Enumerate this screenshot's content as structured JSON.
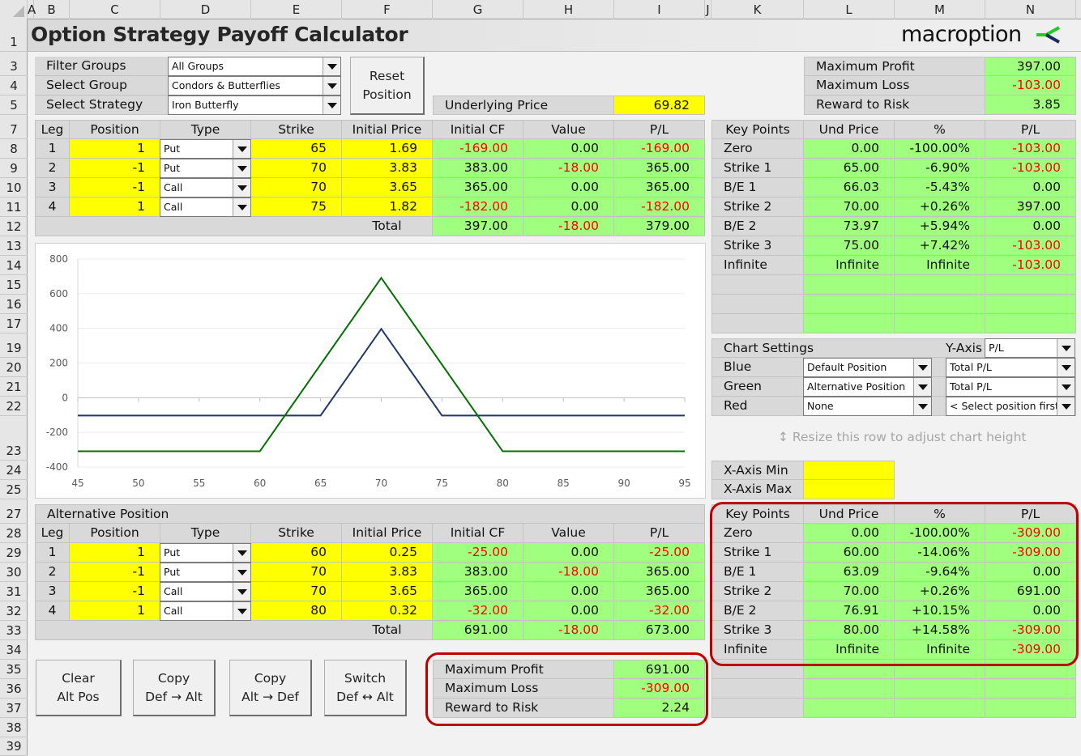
{
  "columns": [
    "A",
    "B",
    "C",
    "D",
    "E",
    "F",
    "G",
    "H",
    "I",
    "J",
    "K",
    "L",
    "M",
    "N"
  ],
  "rows": [
    "1",
    "3",
    "4",
    "5",
    "7",
    "8",
    "9",
    "10",
    "11",
    "12",
    "13",
    "14",
    "15",
    "16",
    "17",
    "19",
    "20",
    "21",
    "22",
    "23",
    "24",
    "25",
    "27",
    "28",
    "29",
    "30",
    "31",
    "32",
    "33",
    "34",
    "35",
    "36",
    "37",
    "38",
    "39"
  ],
  "title": "Option Strategy Payoff Calculator",
  "logo": "macroption",
  "filters": {
    "filter_groups_label": "Filter Groups",
    "filter_groups_value": "All Groups",
    "select_group_label": "Select Group",
    "select_group_value": "Condors & Butterflies",
    "select_strategy_label": "Select Strategy",
    "select_strategy_value": "Iron Butterfly"
  },
  "reset_button": [
    "Reset",
    "Position"
  ],
  "underlying": {
    "label": "Underlying Price",
    "value": "69.82"
  },
  "summary": {
    "max_profit_label": "Maximum Profit",
    "max_profit": "397.00",
    "max_loss_label": "Maximum Loss",
    "max_loss": "-103.00",
    "rr_label": "Reward to Risk",
    "rr": "3.85"
  },
  "legs_headers": [
    "Leg",
    "Position",
    "Type",
    "Strike",
    "Initial Price",
    "Initial CF",
    "Value",
    "P/L"
  ],
  "default_legs": [
    {
      "leg": "1",
      "position": "1",
      "type": "Put",
      "strike": "65",
      "price": "1.69",
      "cf": "-169.00",
      "value": "0.00",
      "pl": "-169.00"
    },
    {
      "leg": "2",
      "position": "-1",
      "type": "Put",
      "strike": "70",
      "price": "3.83",
      "cf": "383.00",
      "value": "-18.00",
      "pl": "365.00"
    },
    {
      "leg": "3",
      "position": "-1",
      "type": "Call",
      "strike": "70",
      "price": "3.65",
      "cf": "365.00",
      "value": "0.00",
      "pl": "365.00"
    },
    {
      "leg": "4",
      "position": "1",
      "type": "Call",
      "strike": "75",
      "price": "1.82",
      "cf": "-182.00",
      "value": "0.00",
      "pl": "-182.00"
    }
  ],
  "default_total": {
    "label": "Total",
    "cf": "397.00",
    "value": "-18.00",
    "pl": "379.00"
  },
  "key_headers": [
    "Key Points",
    "Und Price",
    "%",
    "P/L"
  ],
  "default_keys": [
    {
      "name": "Zero",
      "price": "0.00",
      "pct": "-100.00%",
      "pl": "-103.00"
    },
    {
      "name": "Strike 1",
      "price": "65.00",
      "pct": "-6.90%",
      "pl": "-103.00"
    },
    {
      "name": "B/E 1",
      "price": "66.03",
      "pct": "-5.43%",
      "pl": "0.00"
    },
    {
      "name": "Strike 2",
      "price": "70.00",
      "pct": "+0.26%",
      "pl": "397.00"
    },
    {
      "name": "B/E 2",
      "price": "73.97",
      "pct": "+5.94%",
      "pl": "0.00"
    },
    {
      "name": "Strike 3",
      "price": "75.00",
      "pct": "+7.42%",
      "pl": "-103.00"
    },
    {
      "name": "Infinite",
      "price": "Infinite",
      "pct": "Infinite",
      "pl": "-103.00"
    }
  ],
  "chart_settings": {
    "title": "Chart Settings",
    "yaxis_label": "Y-Axis",
    "yaxis_value": "P/L",
    "rows": [
      {
        "label": "Blue",
        "position": "Default Position",
        "series": "Total P/L"
      },
      {
        "label": "Green",
        "position": "Alternative Position",
        "series": "Total P/L"
      },
      {
        "label": "Red",
        "position": "None",
        "series": "< Select position first"
      }
    ]
  },
  "resize_hint": "Resize this row to adjust chart height",
  "xaxis": {
    "min_label": "X-Axis Min",
    "min_value": "",
    "max_label": "X-Axis Max",
    "max_value": ""
  },
  "alt_title": "Alternative Position",
  "alt_legs": [
    {
      "leg": "1",
      "position": "1",
      "type": "Put",
      "strike": "60",
      "price": "0.25",
      "cf": "-25.00",
      "value": "0.00",
      "pl": "-25.00"
    },
    {
      "leg": "2",
      "position": "-1",
      "type": "Put",
      "strike": "70",
      "price": "3.83",
      "cf": "383.00",
      "value": "-18.00",
      "pl": "365.00"
    },
    {
      "leg": "3",
      "position": "-1",
      "type": "Call",
      "strike": "70",
      "price": "3.65",
      "cf": "365.00",
      "value": "0.00",
      "pl": "365.00"
    },
    {
      "leg": "4",
      "position": "1",
      "type": "Call",
      "strike": "80",
      "price": "0.32",
      "cf": "-32.00",
      "value": "0.00",
      "pl": "-32.00"
    }
  ],
  "alt_total": {
    "label": "Total",
    "cf": "691.00",
    "value": "-18.00",
    "pl": "673.00"
  },
  "alt_keys": [
    {
      "name": "Zero",
      "price": "0.00",
      "pct": "-100.00%",
      "pl": "-309.00"
    },
    {
      "name": "Strike 1",
      "price": "60.00",
      "pct": "-14.06%",
      "pl": "-309.00"
    },
    {
      "name": "B/E 1",
      "price": "63.09",
      "pct": "-9.64%",
      "pl": "0.00"
    },
    {
      "name": "Strike 2",
      "price": "70.00",
      "pct": "+0.26%",
      "pl": "691.00"
    },
    {
      "name": "B/E 2",
      "price": "76.91",
      "pct": "+10.15%",
      "pl": "0.00"
    },
    {
      "name": "Strike 3",
      "price": "80.00",
      "pct": "+14.58%",
      "pl": "-309.00"
    },
    {
      "name": "Infinite",
      "price": "Infinite",
      "pct": "Infinite",
      "pl": "-309.00"
    }
  ],
  "alt_summary": {
    "max_profit_label": "Maximum Profit",
    "max_profit": "691.00",
    "max_loss_label": "Maximum Loss",
    "max_loss": "-309.00",
    "rr_label": "Reward to Risk",
    "rr": "2.24"
  },
  "action_buttons": [
    {
      "line1": "Clear",
      "line2": "Alt Pos"
    },
    {
      "line1": "Copy",
      "line2": "Def → Alt"
    },
    {
      "line1": "Copy",
      "line2": "Alt → Def"
    },
    {
      "line1": "Switch",
      "line2": "Def ↔ Alt"
    }
  ],
  "colors": {
    "blue_series": "#1f3864",
    "green_series": "#007000",
    "highlight": "#c00000",
    "input_yellow": "#ffff00",
    "output_green": "#a0ff7f",
    "negative_red": "#ff0000"
  },
  "chart_data": {
    "type": "line",
    "title": "",
    "xlabel": "",
    "ylabel": "",
    "xlim": [
      45,
      95
    ],
    "ylim": [
      -400,
      800
    ],
    "xticks": [
      45,
      50,
      55,
      60,
      65,
      70,
      75,
      80,
      85,
      90,
      95
    ],
    "yticks": [
      -400,
      -200,
      0,
      200,
      400,
      600,
      800
    ],
    "grid": true,
    "legend": "none",
    "series": [
      {
        "name": "Default Position Total P/L",
        "color": "#1f3864",
        "x": [
          45,
          65,
          70,
          75,
          95
        ],
        "y": [
          -103,
          -103,
          397,
          -103,
          -103
        ]
      },
      {
        "name": "Alternative Position Total P/L",
        "color": "#007000",
        "x": [
          45,
          60,
          70,
          80,
          95
        ],
        "y": [
          -309,
          -309,
          691,
          -309,
          -309
        ]
      }
    ]
  }
}
